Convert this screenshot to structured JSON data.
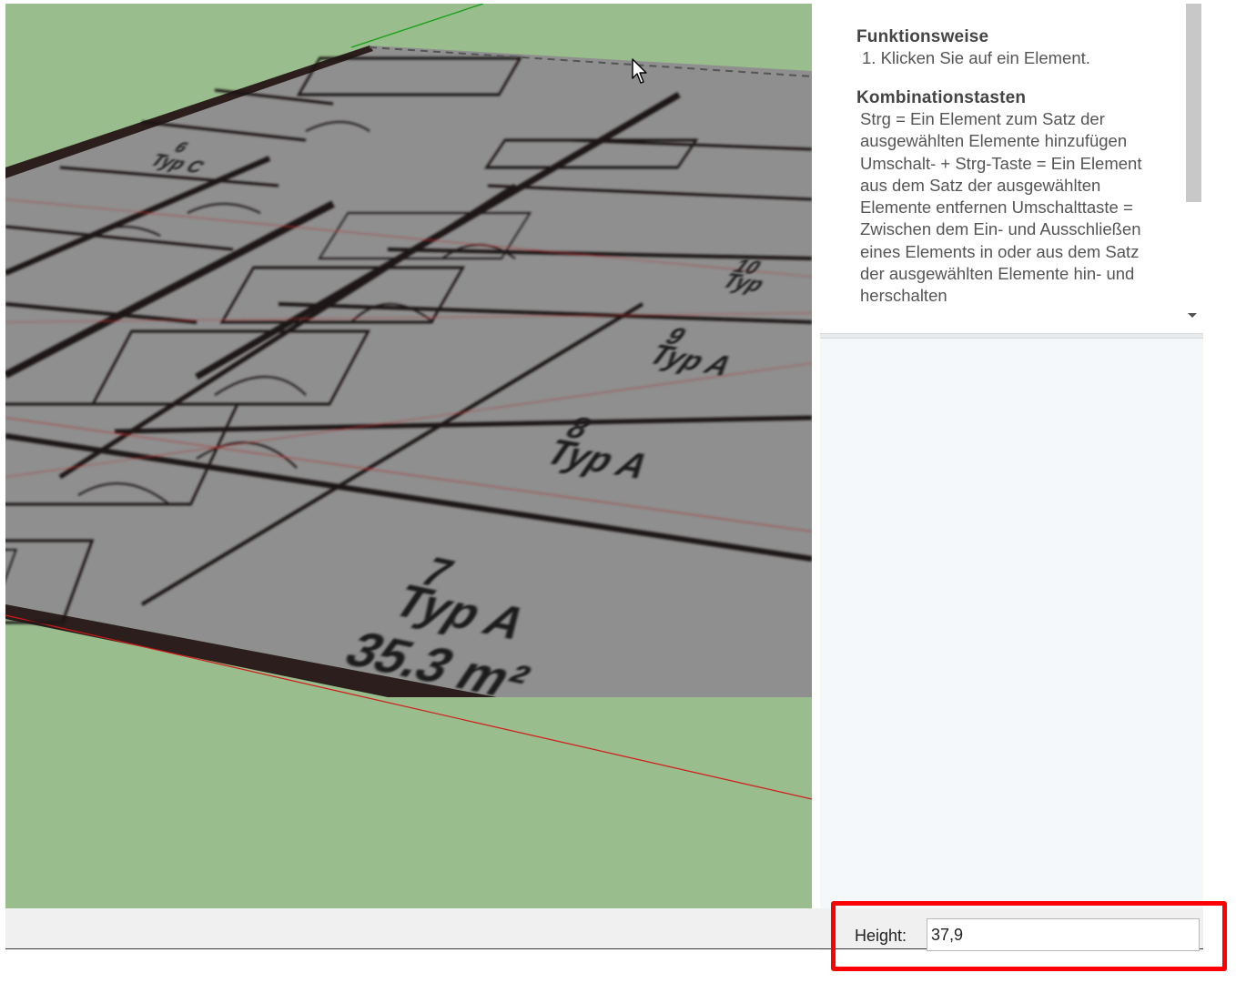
{
  "viewport": {
    "room_labels": [
      {
        "number": "7",
        "type": "Typ A",
        "area": "35.3 m²"
      },
      {
        "number": "8",
        "type": "Typ A"
      },
      {
        "number": "9",
        "type": "Typ A"
      },
      {
        "number": "10",
        "type": "Typ"
      },
      {
        "number": "6",
        "type": "Typ C"
      }
    ],
    "colors": {
      "ground": "#99bd8c",
      "plan": "#8f8f8f",
      "axis_red": "#d21a1a",
      "axis_green": "#14a014"
    }
  },
  "instructor": {
    "section1_title": "Funktionsweise",
    "section1_steps": [
      "1. Klicken Sie auf ein Element."
    ],
    "section2_title": "Kombinationstasten",
    "section2_text": "Strg = Ein Element zum Satz der ausgewählten Elemente hinzufügen Umschalt- + Strg-Taste = Ein Element aus dem Satz der ausgewählten Elemente entfernen Umschalttaste = Zwischen dem Ein- und Ausschließen eines Elements in oder aus dem Satz der ausgewählten Elemente hin- und herschalten"
  },
  "measurements": {
    "label": "Height:",
    "value": "37,9",
    "highlight_color": "#ff0000"
  }
}
